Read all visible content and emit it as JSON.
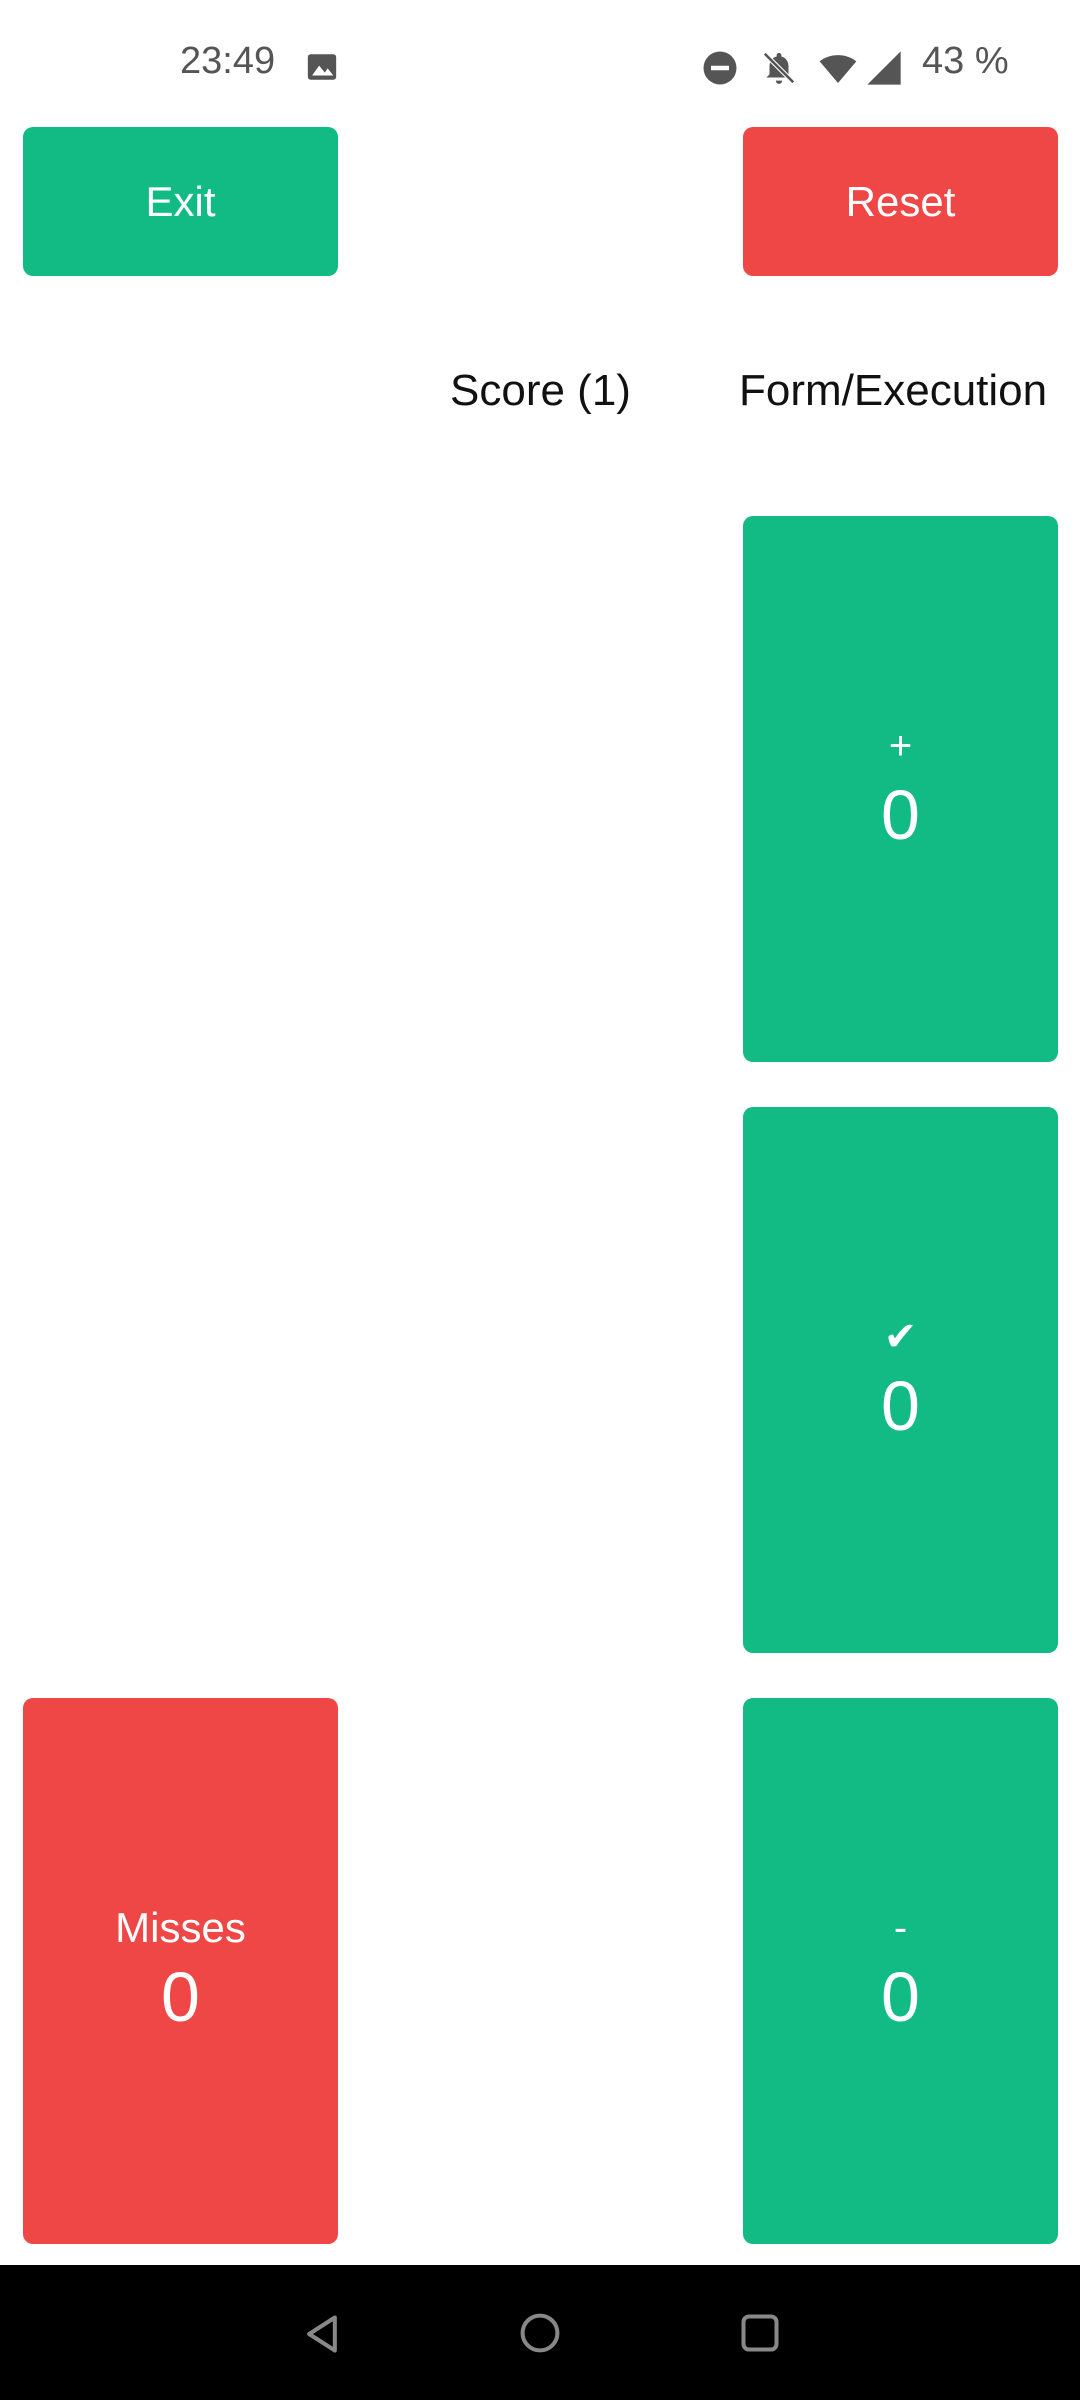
{
  "status_bar": {
    "time": "23:49",
    "battery": "43 %",
    "icons": [
      "image-icon",
      "do-not-disturb-icon",
      "bell-off-icon",
      "wifi-icon",
      "signal-icon"
    ]
  },
  "toolbar": {
    "exit_label": "Exit",
    "reset_label": "Reset"
  },
  "columns": {
    "score_header": "Score (1)",
    "form_header": "Form/Execution"
  },
  "tiles": {
    "plus": {
      "symbol": "+",
      "value": "0"
    },
    "check": {
      "symbol": "✔",
      "value": "0"
    },
    "minus": {
      "symbol": "-",
      "value": "0"
    },
    "misses": {
      "label": "Misses",
      "value": "0"
    }
  },
  "colors": {
    "green": "#12bb84",
    "red": "#ef4646",
    "navbar": "#000000"
  },
  "nav_bar": {
    "icons": [
      "back-icon",
      "home-icon",
      "recents-icon"
    ]
  }
}
